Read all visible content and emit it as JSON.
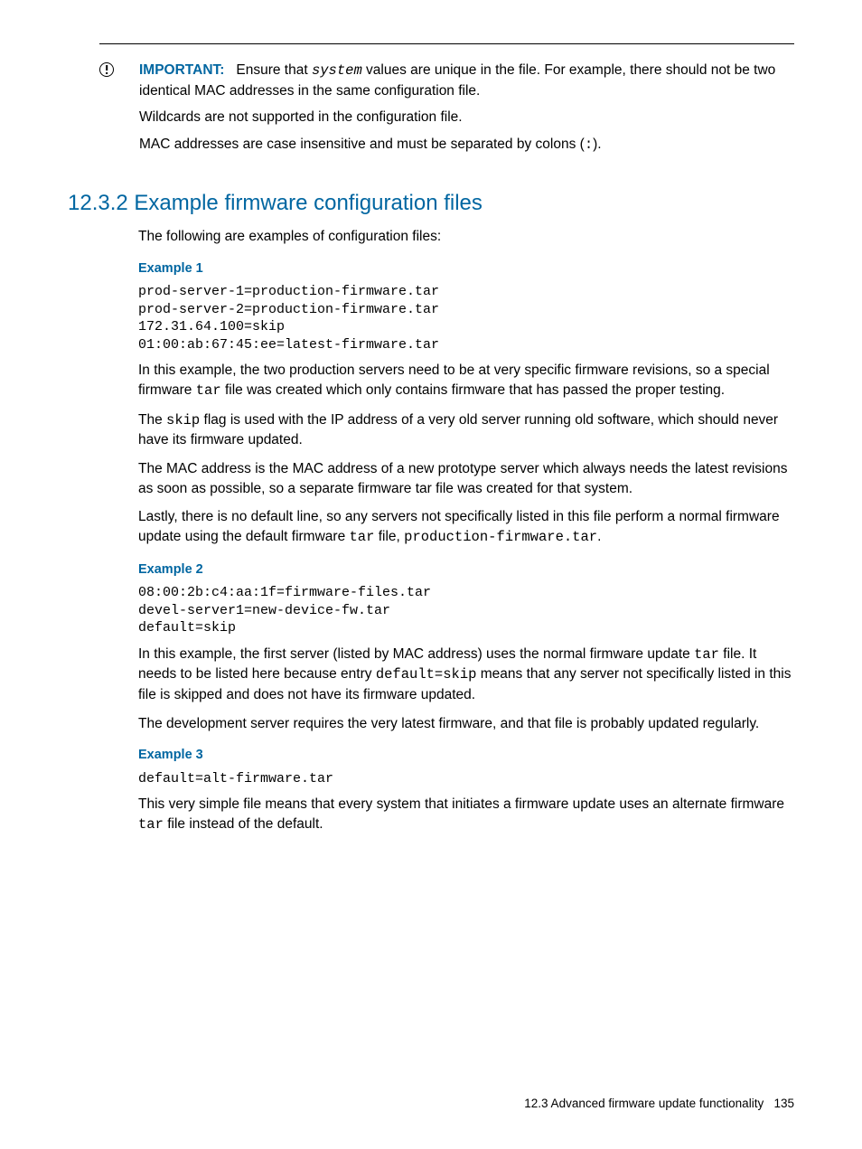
{
  "important": {
    "label": "IMPORTANT:",
    "p1_a": "Ensure that ",
    "p1_sys": "system",
    "p1_b": " values are unique in the file. For example, there should not be two identical MAC addresses in the same configuration file.",
    "p2": "Wildcards are not supported in the configuration file.",
    "p3_a": "MAC addresses are case insensitive and must be separated by colons (",
    "p3_code": ":",
    "p3_b": ")."
  },
  "section": {
    "heading": "12.3.2 Example firmware configuration files",
    "intro": "The following are examples of configuration files:"
  },
  "ex1": {
    "label": "Example 1",
    "code": "prod-server-1=production-firmware.tar\nprod-server-2=production-firmware.tar\n172.31.64.100=skip\n01:00:ab:67:45:ee=latest-firmware.tar",
    "p1_a": "In this example, the two production servers need to be at very specific firmware revisions, so a special firmware ",
    "p1_code": "tar",
    "p1_b": " file was created which only contains firmware that has passed the proper testing.",
    "p2_a": "The ",
    "p2_code": "skip",
    "p2_b": " flag is used with the IP address of a very old server running old software, which should never have its firmware updated.",
    "p3": "The MAC address is the MAC address of a new prototype server which always needs the latest revisions as soon as possible, so a separate firmware tar file was created for that system.",
    "p4_a": "Lastly, there is no default line, so any servers not specifically listed in this file perform a normal firmware update using the default firmware ",
    "p4_code1": "tar",
    "p4_b": " file, ",
    "p4_code2": "production-firmware.tar",
    "p4_c": "."
  },
  "ex2": {
    "label": "Example 2",
    "code": "08:00:2b:c4:aa:1f=firmware-files.tar\ndevel-server1=new-device-fw.tar\ndefault=skip",
    "p1_a": "In this example, the first server (listed by MAC address) uses the normal firmware update ",
    "p1_code1": "tar",
    "p1_b": " file. It needs to be listed here because entry ",
    "p1_code2": "default=skip",
    "p1_c": " means that any server not specifically listed in this file is skipped and does not have its firmware updated.",
    "p2": "The development server requires the very latest firmware, and that file is probably updated regularly."
  },
  "ex3": {
    "label": "Example 3",
    "code": "default=alt-firmware.tar",
    "p1_a": "This very simple file means that every system that initiates a firmware update uses an alternate firmware ",
    "p1_code": "tar",
    "p1_b": " file instead of the default."
  },
  "footer": {
    "text": "12.3 Advanced firmware update functionality",
    "page": "135"
  }
}
